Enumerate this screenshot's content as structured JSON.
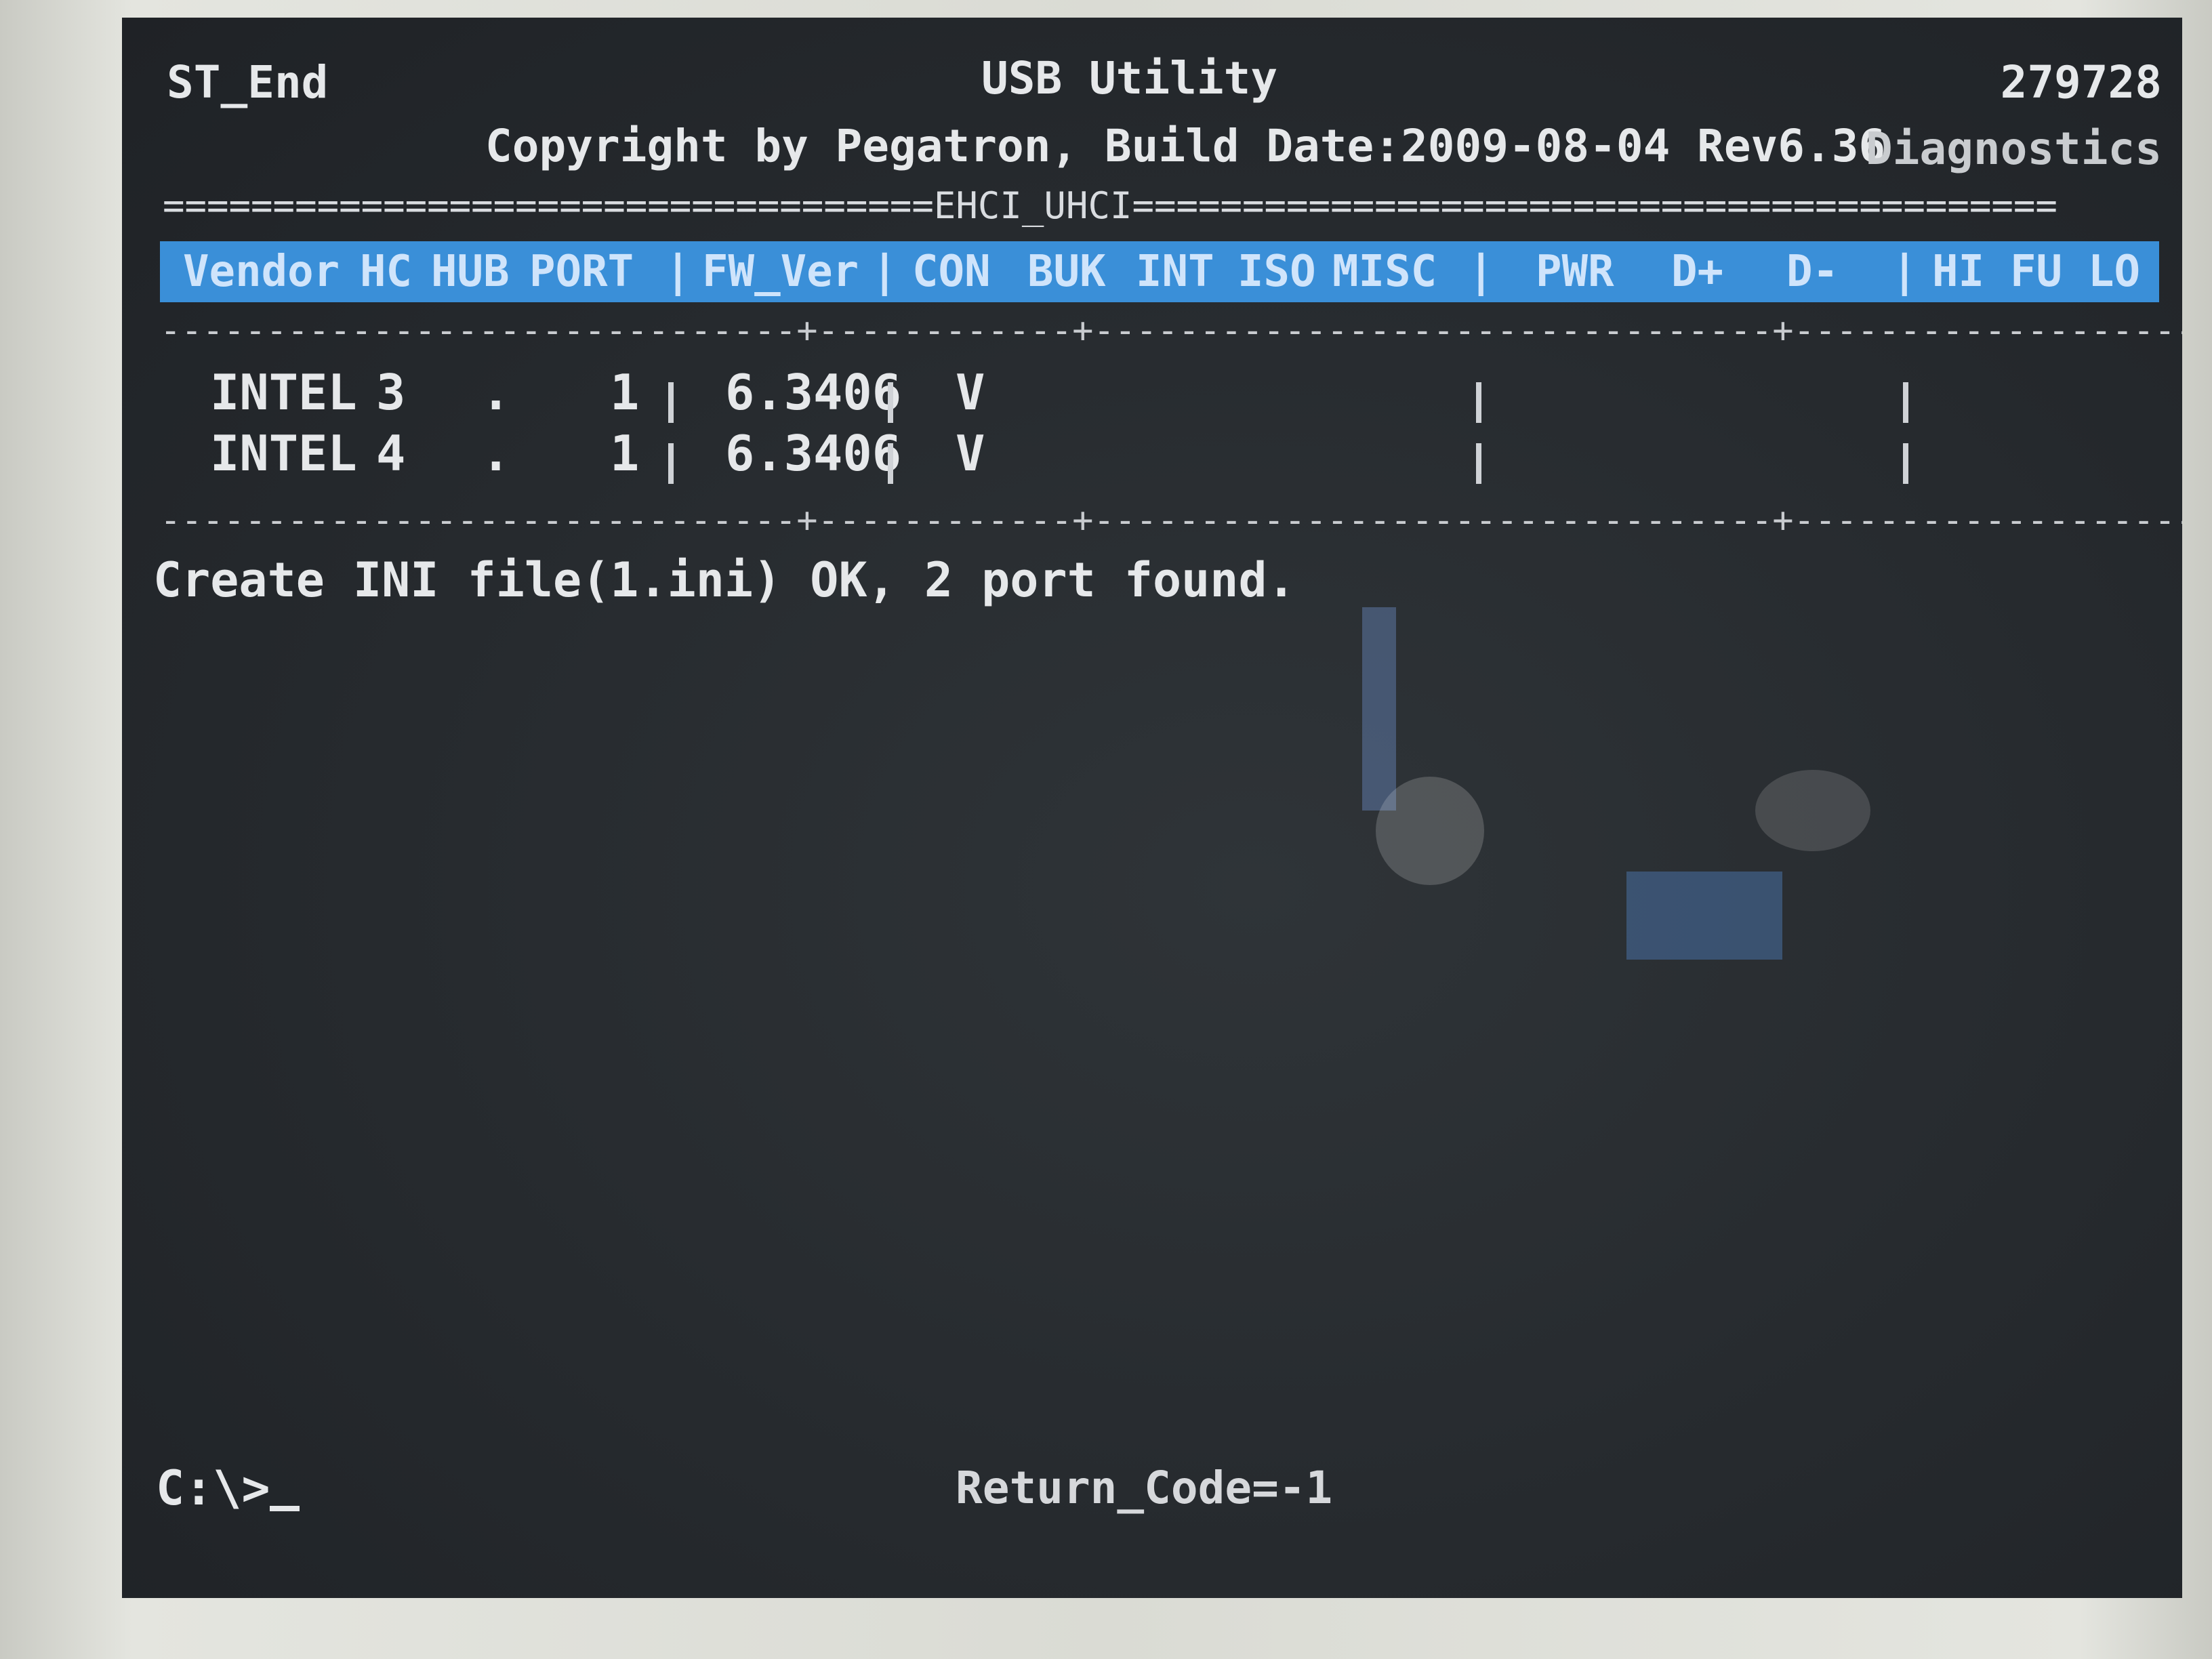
{
  "header": {
    "left_label": "ST_End",
    "title": "USB Utility",
    "build_number": "279728",
    "copyright": "Copyright by Pegatron, Build Date:2009-08-04 Rev6.36",
    "mode": "Diagnostics"
  },
  "separator": "===================================EHCI_UHCI==========================================",
  "columns": [
    "Vendor",
    "HC",
    "HUB",
    "PORT",
    "FW_Ver",
    "CON",
    "BUK",
    "INT",
    "ISO",
    "MISC",
    "PWR",
    "D+",
    "D-",
    "HI",
    "FU",
    "LO"
  ],
  "rows": [
    {
      "vendor": "INTEL",
      "hc": "3",
      "hub": ".",
      "port": "1",
      "fw_ver": "6.3406",
      "con": "V"
    },
    {
      "vendor": "INTEL",
      "hc": "4",
      "hub": ".",
      "port": "1",
      "fw_ver": "6.3406",
      "con": "V"
    }
  ],
  "message": "Create INI file(1.ini) OK, 2 port found.",
  "prompt": "C:\\>",
  "return_code": "Return_Code=-1",
  "colors": {
    "screen_bg": "#262a2e",
    "text": "#e6e8ea",
    "column_bar": "#3a8fd8"
  }
}
